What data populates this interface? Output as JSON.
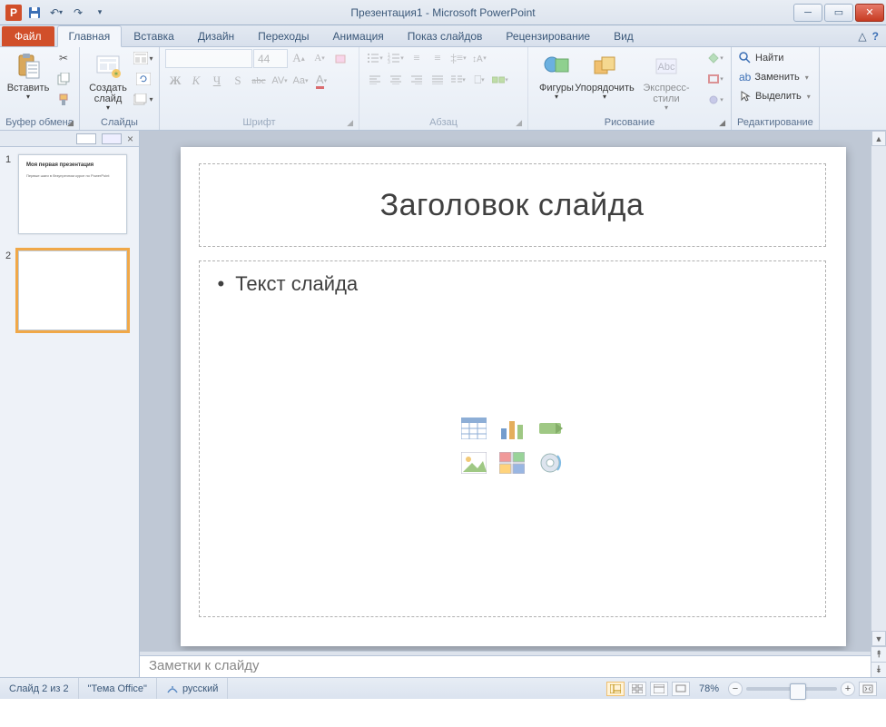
{
  "title": "Презентация1 - Microsoft PowerPoint",
  "app_letter": "P",
  "tabs": {
    "file": "Файл",
    "items": [
      "Главная",
      "Вставка",
      "Дизайн",
      "Переходы",
      "Анимация",
      "Показ слайдов",
      "Рецензирование",
      "Вид"
    ],
    "active": "Главная"
  },
  "ribbon": {
    "clipboard": {
      "label": "Буфер обмена",
      "paste": "Вставить"
    },
    "slides": {
      "label": "Слайды",
      "new": "Создать\nслайд"
    },
    "font": {
      "label": "Шрифт",
      "name": "",
      "size": "44",
      "buttons": [
        "Ж",
        "К",
        "Ч",
        "S",
        "abc",
        "AV",
        "Aa"
      ]
    },
    "paragraph": {
      "label": "Абзац"
    },
    "drawing": {
      "label": "Рисование",
      "shapes": "Фигуры",
      "arrange": "Упорядочить",
      "quick": "Экспресс-стили"
    },
    "editing": {
      "label": "Редактирование",
      "find": "Найти",
      "replace": "Заменить",
      "select": "Выделить"
    }
  },
  "thumbs": [
    {
      "num": "1",
      "title": "Моя первая презентация",
      "body": "Первые шаги в безупречном курсе по PowerPoint"
    },
    {
      "num": "2",
      "title": "",
      "body": ""
    }
  ],
  "slide": {
    "title_placeholder": "Заголовок слайда",
    "body_placeholder": "Текст слайда"
  },
  "notes_placeholder": "Заметки к слайду",
  "status": {
    "slide": "Слайд 2 из 2",
    "theme": "\"Тема Office\"",
    "lang": "русский",
    "zoom": "78%"
  }
}
